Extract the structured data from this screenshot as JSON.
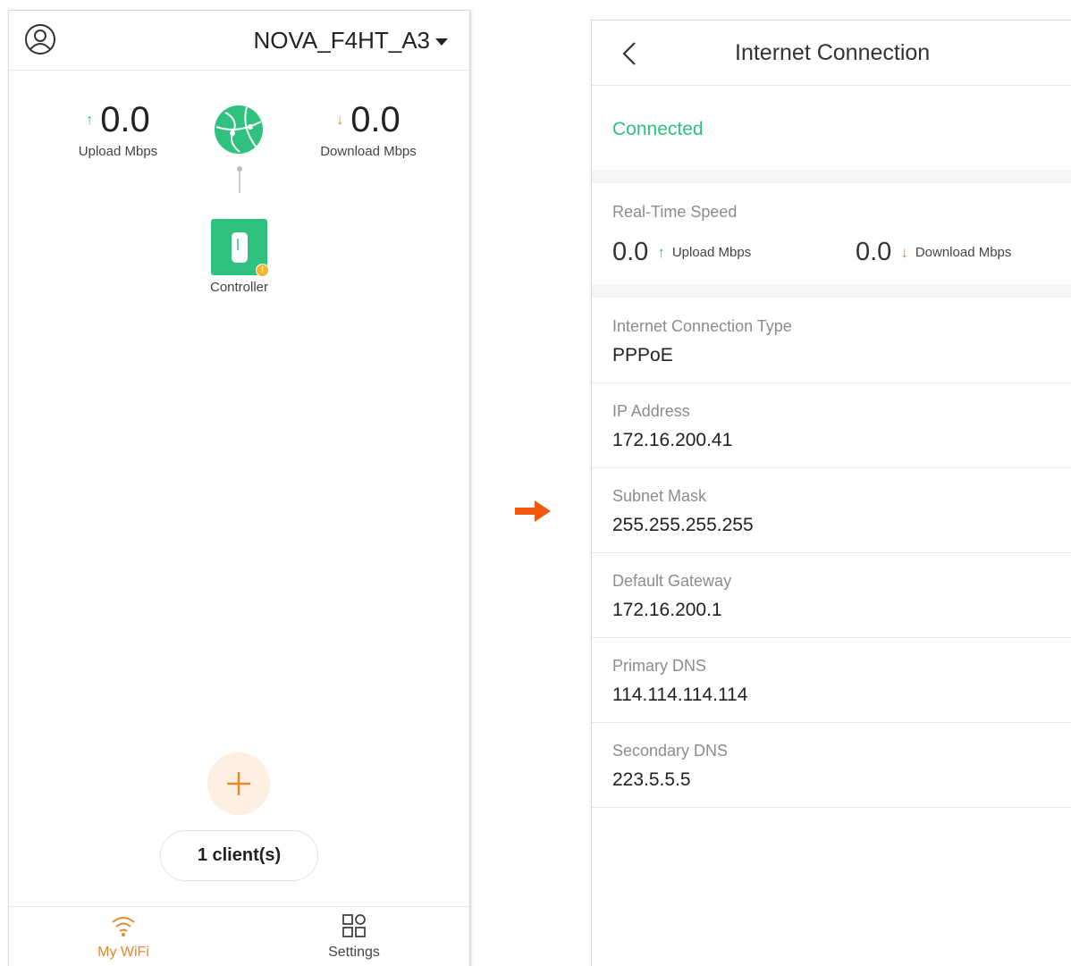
{
  "left_screen": {
    "network_name": "NOVA_F4HT_A3",
    "upload": {
      "value": "0.0",
      "label": "Upload Mbps"
    },
    "download": {
      "value": "0.0",
      "label": "Download Mbps"
    },
    "controller_label": "Controller",
    "controller_badge": "!",
    "clients": "1 client(s)",
    "nav": [
      {
        "label": "My WiFi",
        "icon": "wifi-icon"
      },
      {
        "label": "Settings",
        "icon": "grid-icon"
      }
    ]
  },
  "right_screen": {
    "title": "Internet Connection",
    "status": "Connected",
    "realtime": {
      "label": "Real-Time Speed",
      "upload_value": "0.0",
      "upload_unit": "Upload Mbps",
      "download_value": "0.0",
      "download_unit": "Download Mbps"
    },
    "fields": [
      {
        "label": "Internet Connection Type",
        "value": "PPPoE"
      },
      {
        "label": "IP Address",
        "value": "172.16.200.41"
      },
      {
        "label": "Subnet Mask",
        "value": "255.255.255.255"
      },
      {
        "label": "Default Gateway",
        "value": "172.16.200.1"
      },
      {
        "label": "Primary DNS",
        "value": "114.114.114.114"
      },
      {
        "label": "Secondary DNS",
        "value": "223.5.5.5"
      }
    ]
  },
  "colors": {
    "green": "#2ec27e",
    "orange": "#e5892b",
    "arrow": "#f25a0f"
  }
}
